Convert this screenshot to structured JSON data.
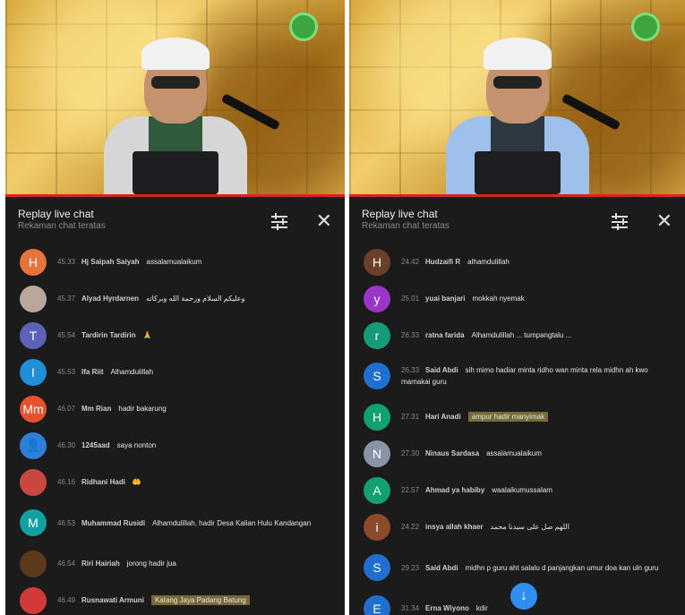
{
  "header": {
    "title": "Replay live chat",
    "subtitle": "Rekaman chat teratas"
  },
  "left_chat": [
    {
      "initial": "H",
      "color": "#e6733a",
      "time": "45.33",
      "author": "Hj Saipah Saiyah",
      "text": "assalamualaikum"
    },
    {
      "initial": "",
      "color": "#b8a79a",
      "time": "45.37",
      "author": "Alyad Hyrdarnen",
      "text": "وعليكم السلام ورحمة الله وبركاته"
    },
    {
      "initial": "T",
      "color": "#5b63b8",
      "time": "45.54",
      "author": "Tardirin Tardirin",
      "text": "🙏"
    },
    {
      "initial": "I",
      "color": "#1e8fd8",
      "time": "45.53",
      "author": "Ifa Riit",
      "text": "Alhamdulillah"
    },
    {
      "initial": "Mm",
      "color": "#e8512e",
      "time": "46.07",
      "author": "Mm Rian",
      "text": "hadir bakarung"
    },
    {
      "initial": "👤",
      "color": "#2e7fd8",
      "time": "46.30",
      "author": "1245aad",
      "text": "saya nonton"
    },
    {
      "initial": "",
      "color": "#c9473f",
      "time": "46.16",
      "author": "Ridhani Hadi",
      "text": "🤲"
    },
    {
      "initial": "M",
      "color": "#12a0a3",
      "time": "46.53",
      "author": "Muhammad Rusidi",
      "text": "Alhamdulillah, hadir Desa Kalian Hulu Kandangan"
    },
    {
      "initial": "",
      "color": "#5a3a1a",
      "time": "46.54",
      "author": "Riri Hairiah",
      "text": "jorong hadir jua"
    },
    {
      "initial": "",
      "color": "#d23a3a",
      "time": "46.49",
      "author": "Rusnawati Armuni",
      "text": "Katang Jaya Padang Batung"
    }
  ],
  "right_chat": [
    {
      "initial": "H",
      "color": "#6b3f2a",
      "time": "24.42",
      "author": "Hudzaifi R",
      "text": "alhamdulillah"
    },
    {
      "initial": "y",
      "color": "#9b34c9",
      "time": "25.01",
      "author": "yuai banjari",
      "text": "mokkah nyemak"
    },
    {
      "initial": "r",
      "color": "#159a7a",
      "time": "26.33",
      "author": "ratna farida",
      "text": "Alhamdulillah ... tumpangtalu ..."
    },
    {
      "initial": "S",
      "color": "#1e6fd0",
      "time": "26.33",
      "author": "Said Abdi",
      "text": "sih mimo hadiar minta ridho wan minta rela midhn ah kwo mamakai guru"
    },
    {
      "initial": "H",
      "color": "#12a070",
      "time": "27.31",
      "author": "Hari Anadi",
      "text": "ampur hadir manyimak"
    },
    {
      "initial": "N",
      "color": "#8895a8",
      "time": "27.30",
      "author": "Ninaus Sardasa",
      "text": "assalamualaikum"
    },
    {
      "initial": "A",
      "color": "#12a070",
      "time": "22.57",
      "author": "Ahmad ya habiby",
      "text": "waalaikumussalam"
    },
    {
      "initial": "i",
      "color": "#8b4a2a",
      "time": "24.22",
      "author": "insya allah khaer",
      "text": "اللهم صل على سيدنا محمد"
    },
    {
      "initial": "S",
      "color": "#1e6fd0",
      "time": "29.23",
      "author": "Said Abdi",
      "text": "midhn p guru aht salalu d panjangkan umur doa kan uln guru"
    },
    {
      "initial": "E",
      "color": "#1e6fd0",
      "time": "31.34",
      "author": "Erna Wiyono",
      "text": "kdir"
    }
  ]
}
